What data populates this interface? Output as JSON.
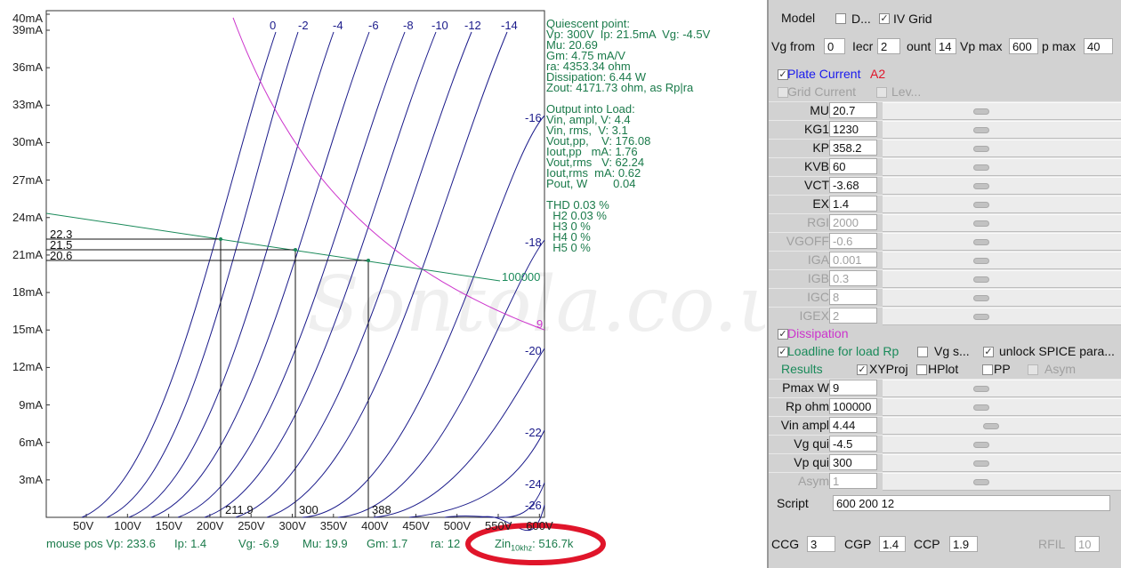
{
  "plot": {
    "y_labels": [
      "40mA",
      "39mA",
      "36mA",
      "33mA",
      "30mA",
      "27mA",
      "24mA",
      "21mA",
      "18mA",
      "15mA",
      "12mA",
      "9mA",
      "6mA",
      "3mA"
    ],
    "x_labels": [
      "50V",
      "100V",
      "150V",
      "200V",
      "250V",
      "300V",
      "350V",
      "400V",
      "450V",
      "500V",
      "550V",
      "600V"
    ],
    "grid_labels_top": [
      "0",
      "-2",
      "-4",
      "-6",
      "-8",
      "-10",
      "-12",
      "-14"
    ],
    "grid_labels_right": [
      "-16",
      "-18",
      "-20",
      "-22",
      "-24",
      "-26"
    ],
    "loadline_label": "100000",
    "dissipation_label": "9",
    "current_markers": [
      "22.3",
      "21.5",
      "20.6"
    ],
    "voltage_markers": [
      "211.9",
      "300",
      "388"
    ],
    "watermark": "Sontola.co.uk",
    "colors": {
      "grid_curves": "#1a1a8a",
      "loadline": "#1a8a5a",
      "dissipation": "#cc33cc",
      "highlight": "#e0152a"
    }
  },
  "info": {
    "quiescent_lines": [
      "Quiescent point:",
      "Vp: 300V  Ip: 21.5mA  Vg: -4.5V",
      "Mu: 20.69",
      "Gm: 4.75 mA/V",
      "ra: 4353.34 ohm",
      "Dissipation: 6.44 W",
      "Zout: 4171.73 ohm, as Rp|ra"
    ],
    "output_lines": [
      "Output into Load:",
      "Vin, ampl, V: 4.4",
      "Vin, rms,  V: 3.1",
      "Vout,pp,    V: 176.08",
      "Iout,pp   mA: 1.76",
      "Vout,rms   V: 62.24",
      "Iout,rms  mA: 0.62",
      "Pout, W        0.04"
    ],
    "thd_lines": [
      "THD 0.03 %",
      "  H2 0.03 %",
      "  H3 0 %",
      "  H4 0 %",
      "  H5 0 %"
    ]
  },
  "status": {
    "mouse_vp": "mouse pos Vp: 233.6",
    "ip": "Ip: 1.4",
    "vg": "Vg: -6.9",
    "mu": "Mu: 19.9",
    "gm": "Gm: 1.7",
    "ra": "ra: 12",
    "zin_prefix": "Zin",
    "zin_sub": "10khz",
    "zin_value": ": 516.7k"
  },
  "panel": {
    "model_label": "Model",
    "d_label": "D...",
    "iv_grid_label": "IV Grid",
    "vg_from_label": "Vg from",
    "vg_from_value": "0",
    "incr_label": "Iecr",
    "incr_value": "2",
    "count_label": "ount",
    "count_value": "14",
    "vp_max_label": "Vp max",
    "vp_max_value": "600",
    "ip_max_label": "p max",
    "ip_max_value": "40",
    "plate_current_label": "Plate Current",
    "a2_label": "A2",
    "grid_current_label": "Grid Current",
    "lev_label": "Lev...",
    "params": [
      {
        "name": "MU",
        "value": "20.7",
        "enabled": true,
        "knob": 0.41
      },
      {
        "name": "KG1",
        "value": "1230",
        "enabled": true,
        "knob": 0.41
      },
      {
        "name": "KP",
        "value": "358.2",
        "enabled": true,
        "knob": 0.41
      },
      {
        "name": "KVB",
        "value": "60",
        "enabled": true,
        "knob": 0.41
      },
      {
        "name": "VCT",
        "value": "-3.68",
        "enabled": true,
        "knob": 0.41
      },
      {
        "name": "EX",
        "value": "1.4",
        "enabled": true,
        "knob": 0.41
      },
      {
        "name": "RGI",
        "value": "2000",
        "enabled": false,
        "knob": 0.41
      },
      {
        "name": "VGOFF",
        "value": "-0.6",
        "enabled": false,
        "knob": 0.41
      },
      {
        "name": "IGA",
        "value": "0.001",
        "enabled": false,
        "knob": 0.41
      },
      {
        "name": "IGB",
        "value": "0.3",
        "enabled": false,
        "knob": 0.41
      },
      {
        "name": "IGC",
        "value": "8",
        "enabled": false,
        "knob": 0.41
      },
      {
        "name": "IGEX",
        "value": "2",
        "enabled": false,
        "knob": 0.41
      }
    ],
    "dissipation_label": "Dissipation",
    "loadline_label": "Loadline for load Rp",
    "vg_s_label": "Vg s...",
    "unlock_label": "unlock SPICE para...",
    "results_label": "Results",
    "xyproj_label": "XYProj",
    "hplot_label": "HPlot",
    "pp_label": "PP",
    "asym_label": "Asym",
    "load_params": [
      {
        "name": "Pmax W",
        "value": "9",
        "enabled": true,
        "knob": 0.41
      },
      {
        "name": "Rp ohm",
        "value": "100000",
        "enabled": true,
        "knob": 0.41
      },
      {
        "name": "Vin ampl",
        "value": "4.44",
        "enabled": true,
        "knob": 0.45
      },
      {
        "name": "Vg qui",
        "value": "-4.5",
        "enabled": true,
        "knob": 0.41
      },
      {
        "name": "Vp qui",
        "value": "300",
        "enabled": true,
        "knob": 0.41
      },
      {
        "name": "Asym",
        "value": "1",
        "enabled": false,
        "knob": 0.41
      }
    ],
    "script_label": "Script",
    "script_value": "600 200 12",
    "ccg_label": "CCG",
    "ccg_value": "3",
    "cgp_label": "CGP",
    "cgp_value": "1.4",
    "ccp_label": "CCP",
    "ccp_value": "1.9",
    "rfil_label": "RFIL",
    "rfil_value": "10",
    "colors": {
      "plate_current": "#1a1aee",
      "a2": "#e0152a",
      "dissipation": "#cc33cc",
      "loadline": "#1a8a5a"
    }
  }
}
